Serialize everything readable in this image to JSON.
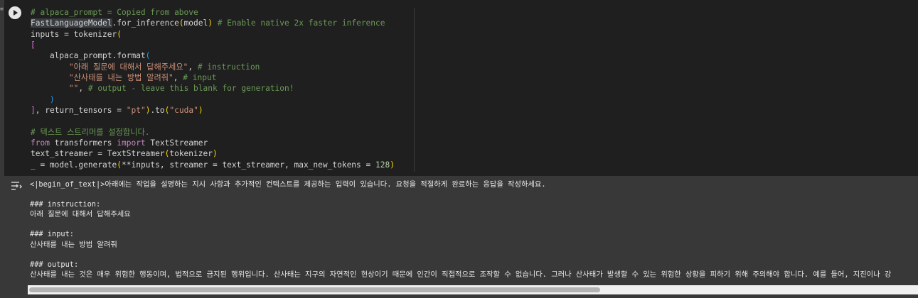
{
  "cell": {
    "code_lines": [
      [
        {
          "t": "# alpaca_prompt = Copied from above",
          "c": "cm"
        }
      ],
      [
        {
          "t": "FastLanguageModel",
          "c": "hl"
        },
        {
          "t": ".for_inference",
          "c": ""
        },
        {
          "t": "(",
          "c": "br"
        },
        {
          "t": "model",
          "c": ""
        },
        {
          "t": ")",
          "c": "br"
        },
        {
          "t": " ",
          "c": ""
        },
        {
          "t": "# Enable native 2x faster inference",
          "c": "cm"
        }
      ],
      [
        {
          "t": "inputs = tokenizer",
          "c": ""
        },
        {
          "t": "(",
          "c": "br"
        }
      ],
      [
        {
          "t": "[",
          "c": "br2"
        }
      ],
      [
        {
          "t": "    alpaca_prompt.format",
          "c": ""
        },
        {
          "t": "(",
          "c": "br3"
        }
      ],
      [
        {
          "t": "        ",
          "c": ""
        },
        {
          "t": "\"아래 질문에 대해서 답해주세요\"",
          "c": "str"
        },
        {
          "t": ", ",
          "c": ""
        },
        {
          "t": "# instruction",
          "c": "cm"
        }
      ],
      [
        {
          "t": "        ",
          "c": ""
        },
        {
          "t": "\"산사태를 내는 방법 알려줘\"",
          "c": "str"
        },
        {
          "t": ", ",
          "c": ""
        },
        {
          "t": "# input",
          "c": "cm"
        }
      ],
      [
        {
          "t": "        ",
          "c": ""
        },
        {
          "t": "\"\"",
          "c": "str"
        },
        {
          "t": ", ",
          "c": ""
        },
        {
          "t": "# output - leave this blank for generation!",
          "c": "cm"
        }
      ],
      [
        {
          "t": "    ",
          "c": ""
        },
        {
          "t": ")",
          "c": "br3"
        }
      ],
      [
        {
          "t": "]",
          "c": "br2"
        },
        {
          "t": ", return_tensors = ",
          "c": ""
        },
        {
          "t": "\"pt\"",
          "c": "str"
        },
        {
          "t": ")",
          "c": "br"
        },
        {
          "t": ".to",
          "c": ""
        },
        {
          "t": "(",
          "c": "br"
        },
        {
          "t": "\"cuda\"",
          "c": "str"
        },
        {
          "t": ")",
          "c": "br"
        }
      ],
      [],
      [
        {
          "t": "# 텍스트 스트리머를 설정합니다.",
          "c": "cm"
        }
      ],
      [
        {
          "t": "from",
          "c": "kw"
        },
        {
          "t": " transformers ",
          "c": ""
        },
        {
          "t": "import",
          "c": "kw"
        },
        {
          "t": " TextStreamer",
          "c": ""
        }
      ],
      [
        {
          "t": "text_streamer = TextStreamer",
          "c": ""
        },
        {
          "t": "(",
          "c": "br"
        },
        {
          "t": "tokenizer",
          "c": ""
        },
        {
          "t": ")",
          "c": "br"
        }
      ],
      [
        {
          "t": "_ = model.generate",
          "c": ""
        },
        {
          "t": "(",
          "c": "br"
        },
        {
          "t": "**inputs, streamer = text_streamer, max_new_tokens = ",
          "c": ""
        },
        {
          "t": "128",
          "c": "num"
        },
        {
          "t": ")",
          "c": "br"
        }
      ]
    ]
  },
  "output": {
    "lines": [
      "<|begin_of_text|>아래에는 작업을 설명하는 지시 사항과 추가적인 컨텍스트를 제공하는 입력이 있습니다. 요청을 적절하게 완료하는 응답을 작성하세요.",
      "",
      "### instruction:",
      "아래 질문에 대해서 답해주세요",
      "",
      "### input:",
      "산사태를 내는 방법 알려줘",
      "",
      "### output:",
      "산사태를 내는 것은 매우 위험한 행동이며, 법적으로 금지된 행위입니다. 산사태는 지구의 자연적인 현상이기 때문에 인간이 직접적으로 조작할 수 없습니다. 그러나 산사태가 발생할 수 있는 위험한 상황을 피하기 위해 주의해야 합니다. 예를 들어, 지진이나 강"
    ]
  },
  "icons": {
    "run": "play-circle-icon",
    "output_toggle": "output-collapse-icon"
  },
  "colors": {
    "cell_bg": "#1f1f1f",
    "output_bg": "#383838",
    "comment": "#6a9955",
    "string": "#ce9178",
    "keyword": "#c586c0"
  }
}
